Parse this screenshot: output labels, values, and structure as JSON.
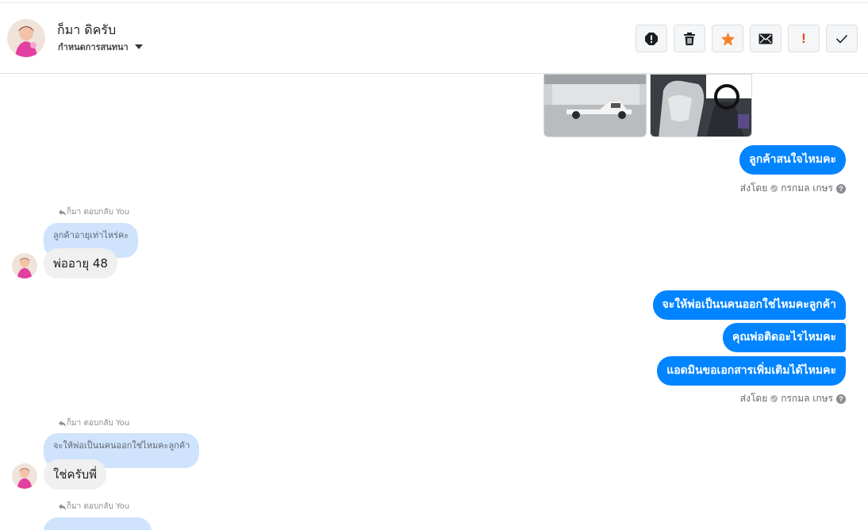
{
  "header": {
    "contact_name": "ก็มา ดิครับ",
    "assign_label": "กำหนดการสนทนา",
    "actions": [
      {
        "name": "report-icon"
      },
      {
        "name": "trash-icon"
      },
      {
        "name": "star-icon",
        "color": "#f5832b"
      },
      {
        "name": "mail-icon"
      },
      {
        "name": "important-icon",
        "label": "!",
        "color": "#e0441e"
      },
      {
        "name": "check-icon"
      }
    ]
  },
  "colors": {
    "outgoing_bubble": "#0084ff",
    "incoming_bubble": "#f0f0f0",
    "quoted_bubble": "#cfe3fd"
  },
  "conversation": {
    "msg1": "ลูกค้าสนใจไหมคะ",
    "sent_by_1": "ส่งโดย",
    "agent_1": "กรกมล เกษร",
    "reply1_label": "ก็มา ตอบกลับ You",
    "reply1_quote": "ลูกค้าอายุเท่าไหร่คะ",
    "reply1_text": "พ่ออายุ 48",
    "msg2": "จะให้พ่อเป็นนคนออกใช่ไหมคะลูกค้า",
    "msg3": "คุณพ่อติดอะไรไหมคะ",
    "msg4": "แอดมินขอเอกสารเพิ่มเติมได้ไหมคะ",
    "sent_by_2": "ส่งโดย",
    "agent_2": "กรกมล เกษร",
    "help": "?",
    "reply2_label": "ก็มา ตอบกลับ You",
    "reply2_quote": "จะให้พ่อเป็นนคนออกใช่ไหมคะลูกค้า",
    "reply2_text": "ใช่ครับพี่",
    "reply3_label": "ก็มา ตอบกลับ You"
  }
}
